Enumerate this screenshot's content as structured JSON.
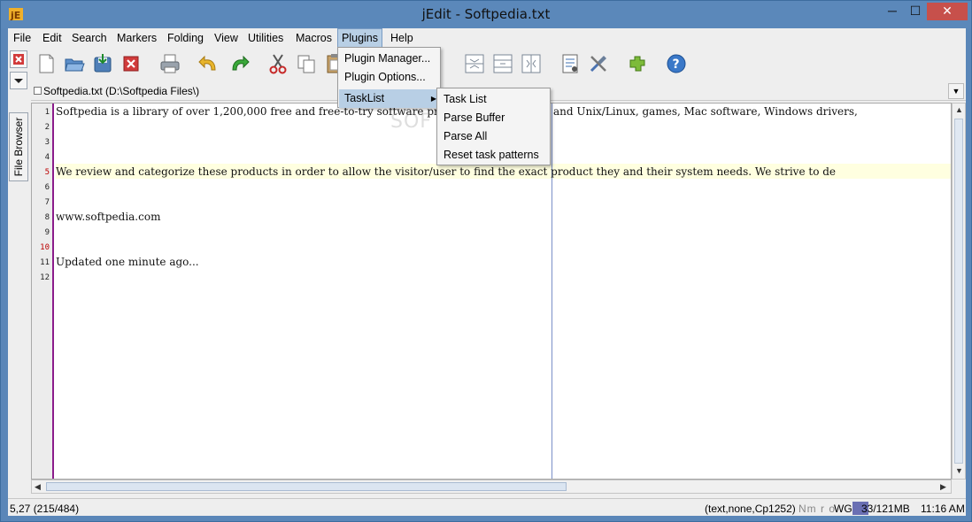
{
  "window": {
    "title": "jEdit - Softpedia.txt",
    "controls": {
      "minimize": "─",
      "maximize": "☐",
      "close": "✕"
    }
  },
  "menubar": {
    "items": [
      "File",
      "Edit",
      "Search",
      "Markers",
      "Folding",
      "View",
      "Utilities",
      "Macros",
      "Plugins",
      "Help"
    ],
    "active": "Plugins"
  },
  "toolbar": {
    "icons": [
      "new-file-icon",
      "open-file-icon",
      "save-file-icon",
      "close-file-icon",
      "print-icon",
      "undo-icon",
      "redo-icon",
      "cut-icon",
      "copy-icon",
      "paste-icon",
      "split-vertical-icon",
      "unsplit-icon",
      "split-horizontal-icon",
      "buffer-options-icon",
      "global-options-icon",
      "plugin-manager-icon",
      "help-icon"
    ]
  },
  "sidebar": {
    "file_browser_label": "File Browser"
  },
  "buffer": {
    "label": "Softpedia.txt (D:\\Softpedia Files\\)"
  },
  "editor": {
    "line_numbers": [
      "1",
      "2",
      "3",
      "4",
      "5",
      "6",
      "7",
      "8",
      "9",
      "10",
      "11",
      "12"
    ],
    "current_line": 5,
    "lines": [
      "Softpedia is a library of over 1,200,000 free and free-to-try software programs for Windows and Unix/Linux, games, Mac software, Windows drivers,",
      "",
      "",
      "",
      "We review and categorize these products in order to allow the visitor/user to find the exact product they and their system needs. We strive to de",
      "",
      "",
      "www.softpedia.com",
      "",
      "",
      "Updated one minute ago...",
      ""
    ]
  },
  "plugins_menu": {
    "items": [
      "Plugin Manager...",
      "Plugin Options...",
      "TaskList"
    ],
    "selected": "TaskList"
  },
  "tasklist_menu": {
    "items": [
      "Task List",
      "Parse Buffer",
      "Parse All",
      "Reset task patterns"
    ]
  },
  "statusbar": {
    "caret": "5,27 (215/484)",
    "mode": "(text,none,Cp1252)",
    "flags": "Nm r o",
    "wg": "WG",
    "memory": "33/121MB",
    "memory_fraction": 0.27,
    "clock": "11:16 AM"
  },
  "watermark": "SOFTPEDIA"
}
